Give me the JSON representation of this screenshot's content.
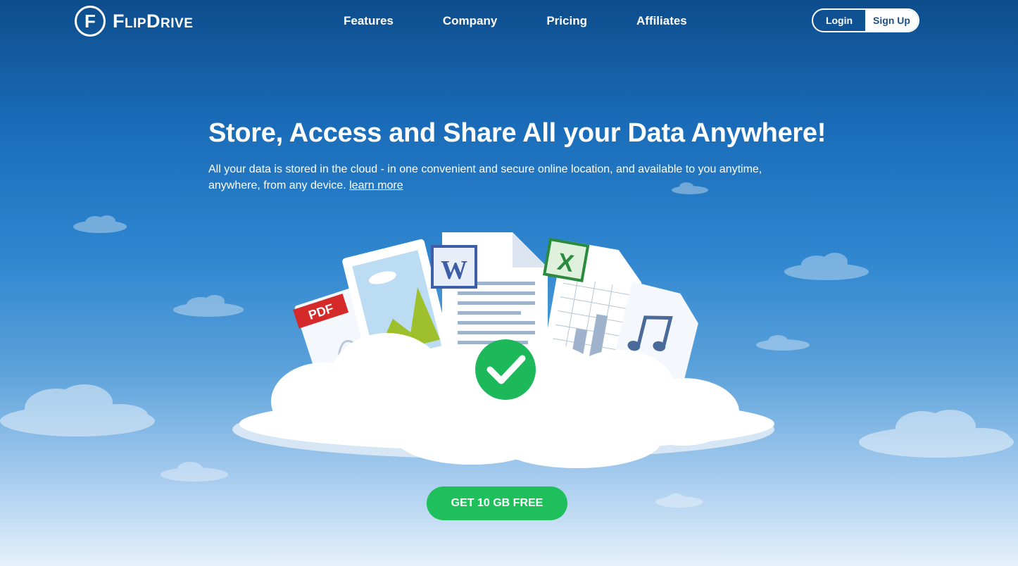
{
  "brand": {
    "name": "FlipDrive",
    "mark": "F"
  },
  "nav": [
    {
      "label": "Features"
    },
    {
      "label": "Company"
    },
    {
      "label": "Pricing"
    },
    {
      "label": "Affiliates"
    }
  ],
  "auth": {
    "login_label": "Login",
    "signup_label": "Sign Up"
  },
  "hero": {
    "title": "Store, Access and Share All your Data Anywhere!",
    "subtitle": "All your data is stored in the cloud - in one convenient and secure online location, and available to you anytime, anywhere, from any device.",
    "learn_more": "learn more"
  },
  "illustration": {
    "pdf_label": "PDF",
    "word_label": "W",
    "excel_label": "X"
  },
  "cta": {
    "label": "GET 10 GB FREE"
  },
  "colors": {
    "accent_green": "#1fc05b",
    "brand_blue": "#1a4f85"
  }
}
